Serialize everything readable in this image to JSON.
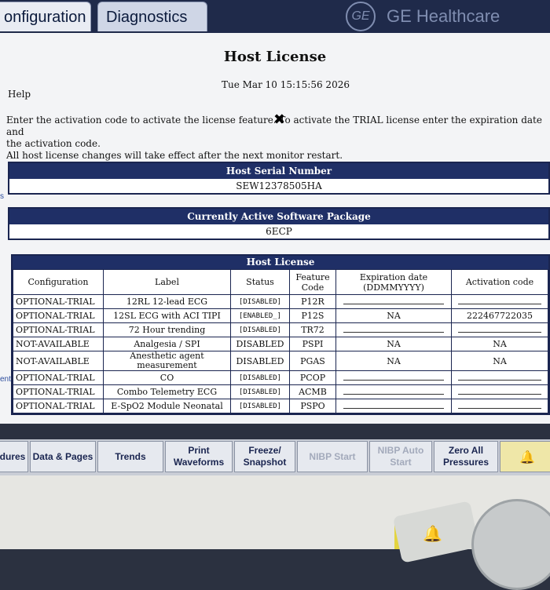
{
  "tabs": [
    "onfiguration",
    "Diagnostics"
  ],
  "brand": "GE Healthcare",
  "title": "Host License",
  "datetime": "Tue Mar 10 15:15:56 2026",
  "help": "Help",
  "instructions": [
    "Enter the activation code to activate the license feature. To activate the TRIAL license enter the expiration date and",
    "the activation code.",
    "All host license changes will take effect after the next monitor restart."
  ],
  "left_marks": [
    "s",
    "ent"
  ],
  "serial": {
    "header": "Host Serial Number",
    "value": "SEW12378505HA"
  },
  "package": {
    "header": "Currently Active Software Package",
    "value": "6ECP"
  },
  "license": {
    "header": "Host License",
    "columns": [
      "Configuration",
      "Label",
      "Status",
      "Feature Code",
      "Expiration date (DDMMYYYY)",
      "Activation code"
    ],
    "rows": [
      {
        "config": "OPTIONAL-TRIAL",
        "label": "12RL 12-lead ECG",
        "status": "[DISABLED]",
        "code": "P12R",
        "expiration": "",
        "activation": ""
      },
      {
        "config": "OPTIONAL-TRIAL",
        "label": "12SL ECG with ACI TIPI",
        "status": "[ENABLED_]",
        "code": "P12S",
        "expiration": "NA",
        "activation": "222467722035"
      },
      {
        "config": "OPTIONAL-TRIAL",
        "label": "72 Hour trending",
        "status": "[DISABLED]",
        "code": "TR72",
        "expiration": "",
        "activation": ""
      },
      {
        "config": "NOT-AVAILABLE",
        "label": "Analgesia / SPI",
        "status": "DISABLED",
        "code": "PSPI",
        "expiration": "NA",
        "activation": "NA"
      },
      {
        "config": "NOT-AVAILABLE",
        "label": "Anesthetic agent measurement",
        "status": "DISABLED",
        "code": "PGAS",
        "expiration": "NA",
        "activation": "NA"
      },
      {
        "config": "OPTIONAL-TRIAL",
        "label": "CO",
        "status": "[DISABLED]",
        "code": "PCOP",
        "expiration": "",
        "activation": ""
      },
      {
        "config": "OPTIONAL-TRIAL",
        "label": "Combo Telemetry ECG",
        "status": "[DISABLED]",
        "code": "ACMB",
        "expiration": "",
        "activation": ""
      },
      {
        "config": "OPTIONAL-TRIAL",
        "label": "E-SpO2 Module Neonatal",
        "status": "[DISABLED]",
        "code": "PSPO",
        "expiration": "",
        "activation": ""
      }
    ]
  },
  "bottom_buttons": [
    {
      "label": "dures",
      "enabled": true
    },
    {
      "label": "Data & Pages",
      "enabled": true
    },
    {
      "label": "Trends",
      "enabled": true
    },
    {
      "label": "Print Waveforms",
      "enabled": true
    },
    {
      "label": "Freeze/ Snapshot",
      "enabled": true
    },
    {
      "label": "NIBP Start",
      "enabled": false
    },
    {
      "label": "NIBP Auto Start",
      "enabled": false
    },
    {
      "label": "Zero All Pressures",
      "enabled": true
    },
    {
      "label": "bell-icon",
      "enabled": true
    }
  ]
}
